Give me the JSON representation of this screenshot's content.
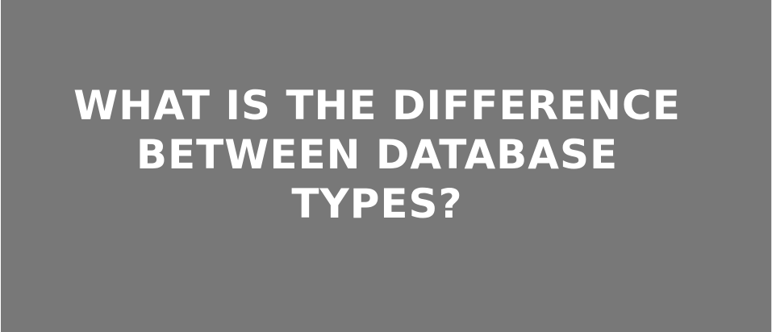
{
  "headline": {
    "lines": [
      "WHAT IS THE DIFFERENCE",
      "BETWEEN DATABASE",
      "TYPES?"
    ]
  },
  "colors": {
    "background": "#787878",
    "text": "#ffffff"
  }
}
